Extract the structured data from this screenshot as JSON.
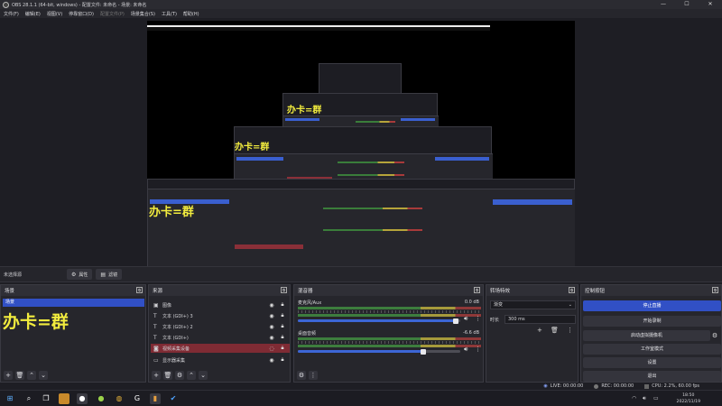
{
  "window": {
    "title": "OBS 28.1.1 (64-bit, windows) - 配置文件: 未命名 - 场景: 未命名",
    "controls": [
      "—",
      "☐",
      "✕"
    ]
  },
  "menubar": {
    "items": [
      "文件(F)",
      "编辑(E)",
      "视图(V)",
      "停靠窗口(D)",
      "配置文件(P)",
      "场景集合(S)",
      "工具(T)",
      "帮助(H)"
    ]
  },
  "preview": {
    "overlay_text": "办卡=群"
  },
  "context_bar": {
    "label": "未选择源",
    "properties_label": "属性",
    "filters_label": "滤镜"
  },
  "scenes": {
    "title": "场景",
    "items": [
      "场景"
    ],
    "overlay_text": "办卡=群"
  },
  "sources": {
    "title": "来源",
    "items": [
      {
        "name": "图像",
        "icon": "image-icon"
      },
      {
        "name": "文本 (GDI+) 3",
        "icon": "text-icon"
      },
      {
        "name": "文本 (GDI+) 2",
        "icon": "text-icon"
      },
      {
        "name": "文本 (GDI+)",
        "icon": "text-icon"
      },
      {
        "name": "视频采集设备",
        "icon": "camera-icon"
      },
      {
        "name": "显示器采集",
        "icon": "monitor-icon"
      }
    ]
  },
  "mixer": {
    "title": "混音器",
    "channels": [
      {
        "name": "麦克风/Aux",
        "db": "0.0 dB",
        "level": 0.0,
        "volume": 0.97
      },
      {
        "name": "桌面音频",
        "db": "-6.6 dB",
        "level": 0.0,
        "volume": 0.77
      }
    ]
  },
  "transitions": {
    "title": "转场特效",
    "selected": "渐变",
    "duration_label": "时长",
    "duration_value": "300 ms"
  },
  "controls": {
    "title": "控制按钮",
    "buttons": [
      "停止直播",
      "开始录制",
      "启动虚拟摄像机",
      "工作室模式",
      "设置",
      "退出"
    ]
  },
  "statusbar": {
    "live": "LIVE: 00:00:00",
    "rec": "REC: 00:00:00",
    "cpu": "CPU: 2.2%, 60.00 fps"
  },
  "taskbar": {
    "time": "18:50",
    "date": "2022/11/19"
  },
  "colors": {
    "accent_blue": "#3150c5",
    "selected_source_red": "#7f2b34",
    "overlay_yellow": "#f2ec3e"
  }
}
